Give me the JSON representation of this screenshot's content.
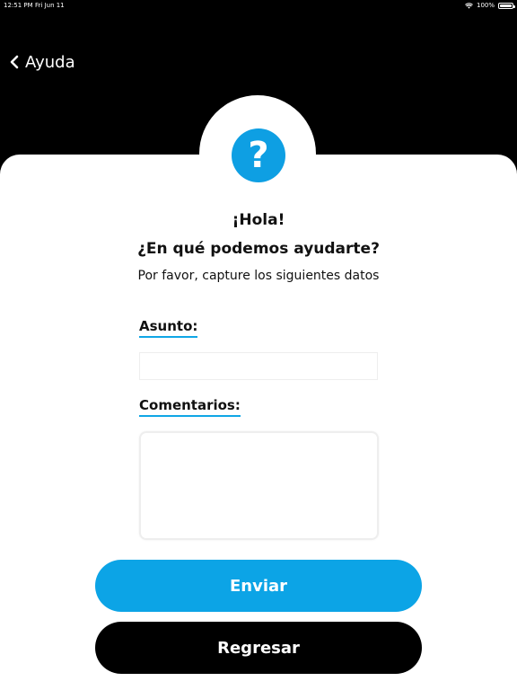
{
  "status_bar": {
    "time": "12:51 PM",
    "date": "Fri Jun 11",
    "battery": "100%"
  },
  "nav": {
    "back_label": "Ayuda"
  },
  "header": {
    "greeting": "¡Hola!",
    "question": "¿En qué podemos ayudarte?",
    "instructions": "Por favor, capture los siguientes datos",
    "help_symbol": "?"
  },
  "form": {
    "subject_label": "Asunto:",
    "subject_value": "",
    "comments_label": "Comentarios:",
    "comments_value": ""
  },
  "actions": {
    "send_label": "Enviar",
    "back_label": "Regresar"
  },
  "colors": {
    "accent": "#0ca4e6",
    "background": "#000000",
    "card": "#ffffff"
  },
  "icons": {
    "back": "chevron-left-icon",
    "help": "question-mark-icon",
    "wifi": "wifi-icon",
    "battery": "battery-icon"
  }
}
